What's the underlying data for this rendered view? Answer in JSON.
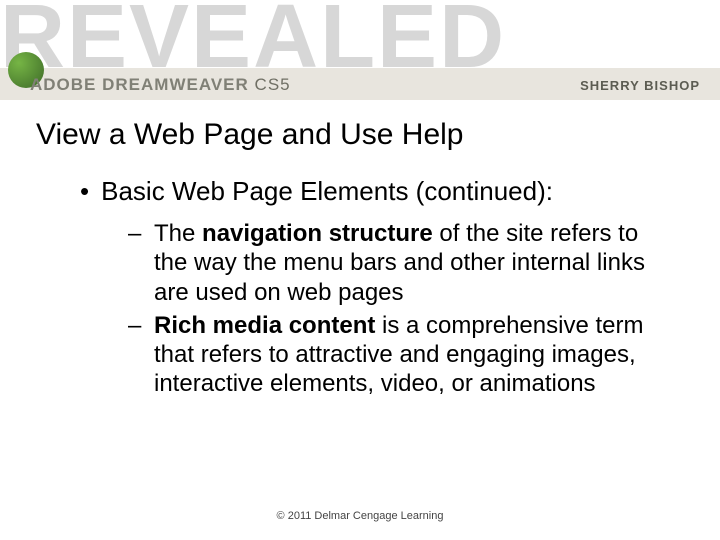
{
  "banner": {
    "revealed": "REVEALED",
    "product_prefix": "ADOBE DREAMWEAVER",
    "product_suffix": "CS5",
    "author": "SHERRY BISHOP"
  },
  "slide": {
    "title": "View a Web Page and Use Help",
    "level1": "Basic Web Page Elements (continued):",
    "item1_pre": "The ",
    "item1_bold": "navigation structure",
    "item1_post": " of the site refers to the way the menu bars and other internal links are used on web pages",
    "item2_bold": "Rich media content",
    "item2_post": " is a comprehensive term that refers to attractive and engaging images, interactive elements, video, or animations"
  },
  "footer": {
    "copyright": "© 2011 Delmar Cengage Learning"
  }
}
